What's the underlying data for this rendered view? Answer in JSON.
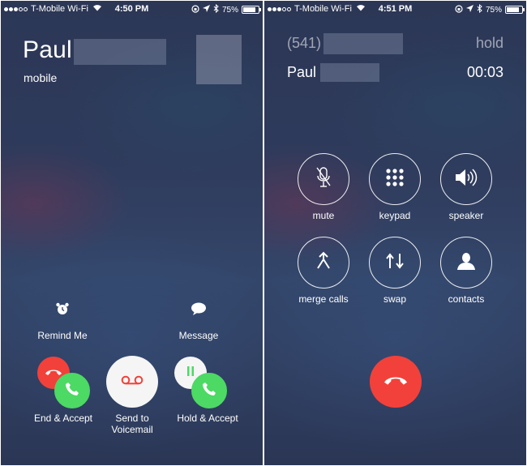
{
  "left_screen": {
    "status": {
      "carrier": "T-Mobile Wi-Fi",
      "time": "4:50 PM",
      "battery": "75%",
      "battery_level": 0.75
    },
    "caller": {
      "first_name": "Paul",
      "type": "mobile"
    },
    "actions": {
      "remind_label": "Remind Me",
      "message_label": "Message"
    },
    "buttons": {
      "end_accept_label": "End & Accept",
      "voicemail_label_line1": "Send to",
      "voicemail_label_line2": "Voicemail",
      "hold_accept_label": "Hold & Accept"
    }
  },
  "right_screen": {
    "status": {
      "carrier": "T-Mobile Wi-Fi",
      "time": "4:51 PM",
      "battery": "75%",
      "battery_level": 0.75
    },
    "held_call": {
      "number": "(541)",
      "state": "hold"
    },
    "active_call": {
      "first_name": "Paul",
      "duration": "00:03"
    },
    "controls": {
      "mute": "mute",
      "keypad": "keypad",
      "speaker": "speaker",
      "merge": "merge calls",
      "swap": "swap",
      "contacts": "contacts"
    }
  },
  "colors": {
    "end_red": "#f2413a",
    "accept_green": "#4cd964",
    "background": "#2f3b5c"
  },
  "icons": [
    "alarm-clock-icon",
    "speech-bubble-icon",
    "phone-hangup-icon",
    "phone-icon",
    "voicemail-icon",
    "pause-icon",
    "microphone-muted-icon",
    "keypad-grid-icon",
    "speaker-icon",
    "merge-icon",
    "swap-icon",
    "contact-person-icon"
  ]
}
